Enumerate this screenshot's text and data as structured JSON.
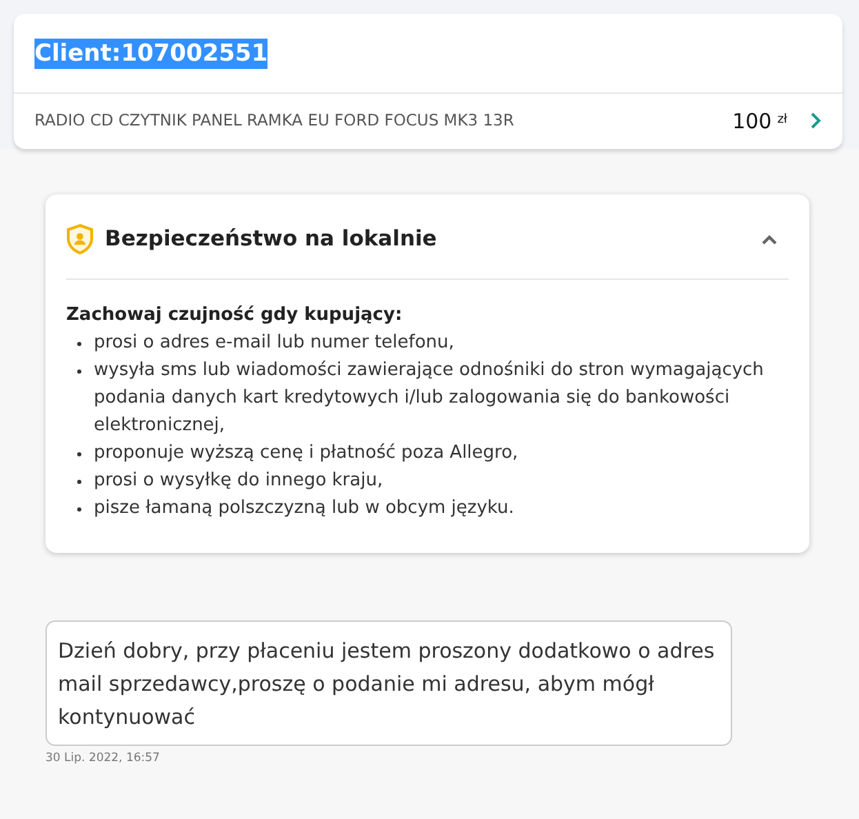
{
  "header": {
    "title": "Client:107002551",
    "title_selected": true,
    "product": {
      "name": "RADIO CD CZYTNIK PANEL RAMKA EU FORD FOCUS MK3 13R",
      "price": "100",
      "currency": "zł"
    }
  },
  "safety": {
    "title": "Bezpieczeństwo na lokalnie",
    "expanded": true,
    "intro": "Zachowaj czujność gdy kupujący:",
    "items": [
      "prosi o adres e-mail lub numer telefonu,",
      "wysyła sms lub wiadomości zawierające odnośniki do stron wymagających podania danych kart kredytowych i/lub zalogowania się do bankowości elektronicznej,",
      "proponuje wyższą cenę i płatność poza Allegro,",
      "prosi o wysyłkę do innego kraju,",
      "pisze łamaną polszczyzną lub w obcym języku."
    ]
  },
  "messages": [
    {
      "text": "Dzień dobry, przy płaceniu jestem proszony dodatkowo o adres mail sprzedawcy,proszę o podanie mi adresu, abym mógł kontynuować",
      "time": "30 Lip. 2022, 16:57"
    }
  ]
}
